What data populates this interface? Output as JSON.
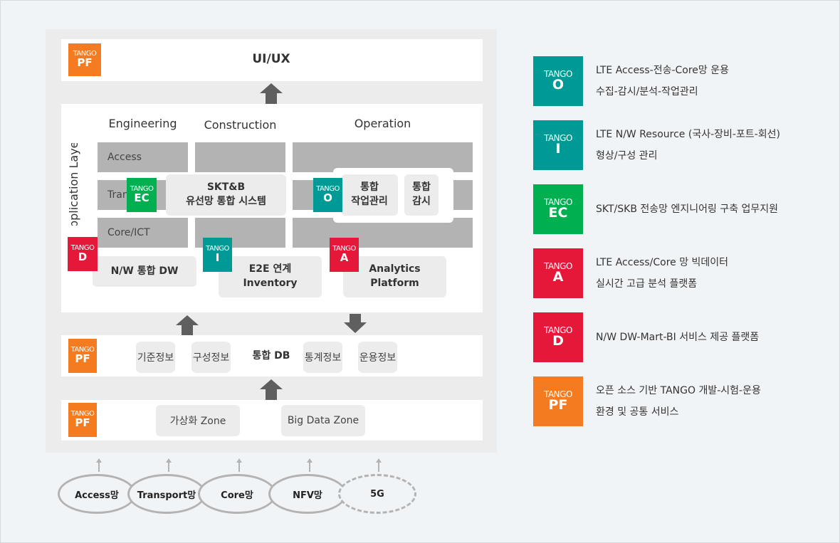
{
  "colors": {
    "teal": "#009a96",
    "green": "#00b050",
    "red": "#e5183a",
    "orange": "#f47b20",
    "gray": "#b3b3b3"
  },
  "tango": "TANGO",
  "uiux": "UI/UX",
  "app_layer": {
    "label": "Application Layer",
    "columns": [
      "Engineering",
      "Construction",
      "Operation"
    ],
    "rows": [
      "Access",
      "Transport",
      "Core/ICT"
    ]
  },
  "ec_box": {
    "code": "EC",
    "line1": "SKT&B",
    "line2": "유선망 통합 시스템"
  },
  "o_box": {
    "code": "O",
    "work": [
      "통합",
      "작업관리"
    ],
    "monitor": [
      "통합",
      "감시"
    ]
  },
  "d_box": {
    "code": "D",
    "label": "N/W 통합 DW"
  },
  "i_box": {
    "code": "I",
    "line1": "E2E 연계",
    "line2": "Inventory"
  },
  "a_box": {
    "code": "A",
    "line1": "Analytics",
    "line2": "Platform"
  },
  "db_band": {
    "code": "PF",
    "items": [
      "기준정보",
      "구성정보"
    ],
    "center": "통합 DB",
    "items2": [
      "통계정보",
      "운용정보"
    ]
  },
  "zone_band": {
    "code": "PF",
    "zones": [
      "가상화 Zone",
      "Big Data Zone"
    ]
  },
  "networks": [
    "Access망",
    "Transport망",
    "Core망",
    "NFV망",
    "5G"
  ],
  "legend": [
    {
      "code": "O",
      "color": "teal",
      "lines": [
        "LTE Access-전송-Core망 운용",
        "수집-감시/분석-작업관리"
      ]
    },
    {
      "code": "I",
      "color": "teal",
      "lines": [
        "LTE N/W Resource (국사-장비-포트-회선)",
        "형상/구성 관리"
      ]
    },
    {
      "code": "EC",
      "color": "green",
      "lines": [
        "SKT/SKB 전송망 엔지니어링 구축 업무지원"
      ]
    },
    {
      "code": "A",
      "color": "red",
      "lines": [
        "LTE Access/Core 망 빅데이터",
        "실시간 고급 분석 플랫폼"
      ]
    },
    {
      "code": "D",
      "color": "red",
      "lines": [
        "N/W DW-Mart-BI 서비스 제공 플랫폼"
      ]
    },
    {
      "code": "PF",
      "color": "orange",
      "lines": [
        "오픈 소스 기반 TANGO 개발-시험-운용",
        "환경 및 공통 서비스"
      ]
    }
  ]
}
